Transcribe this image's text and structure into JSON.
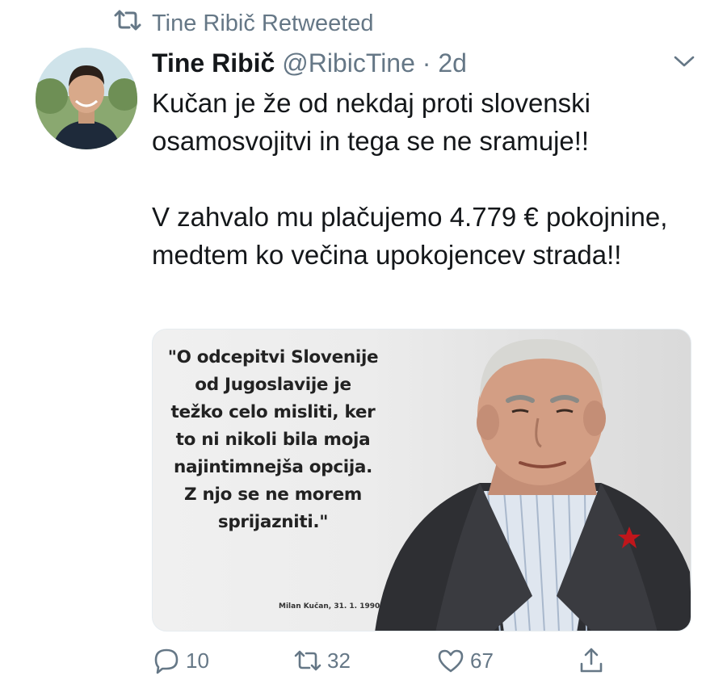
{
  "retweet": {
    "icon": "retweet-icon",
    "text": "Tine Ribič Retweeted"
  },
  "tweet": {
    "author_name": "Tine Ribič",
    "author_handle": "@RibicTine",
    "separator": " · ",
    "time": "2d",
    "paragraphs": [
      "Kučan je že od nekdaj proti slovenski osamosvojitvi in tega se ne sramuje!!",
      "V zahvalo mu plačujemo 4.779 € pokojnine, medtem ko večina upokojencev strada!!"
    ]
  },
  "media": {
    "quote": "\"O odcepitvi Slovenije od Jugoslavije je težko celo misliti, ker to ni nikoli bila moja najintimnejša opcija. Z njo se ne morem sprijazniti.\"",
    "quote_author": "Milan Kučan, 31. 1. 1990"
  },
  "actions": {
    "reply_count": "10",
    "retweet_count": "32",
    "like_count": "67"
  },
  "colors": {
    "text": "#14171a",
    "secondary": "#657786",
    "star": "#c0161b"
  }
}
